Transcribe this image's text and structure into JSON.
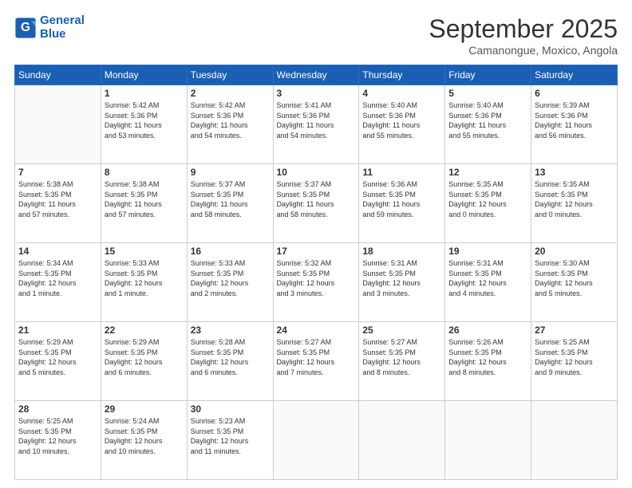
{
  "header": {
    "logo_line1": "General",
    "logo_line2": "Blue",
    "month": "September 2025",
    "location": "Camanongue, Moxico, Angola"
  },
  "weekdays": [
    "Sunday",
    "Monday",
    "Tuesday",
    "Wednesday",
    "Thursday",
    "Friday",
    "Saturday"
  ],
  "weeks": [
    [
      {
        "day": "",
        "info": ""
      },
      {
        "day": "1",
        "info": "Sunrise: 5:42 AM\nSunset: 5:36 PM\nDaylight: 11 hours\nand 53 minutes."
      },
      {
        "day": "2",
        "info": "Sunrise: 5:42 AM\nSunset: 5:36 PM\nDaylight: 11 hours\nand 54 minutes."
      },
      {
        "day": "3",
        "info": "Sunrise: 5:41 AM\nSunset: 5:36 PM\nDaylight: 11 hours\nand 54 minutes."
      },
      {
        "day": "4",
        "info": "Sunrise: 5:40 AM\nSunset: 5:36 PM\nDaylight: 11 hours\nand 55 minutes."
      },
      {
        "day": "5",
        "info": "Sunrise: 5:40 AM\nSunset: 5:36 PM\nDaylight: 11 hours\nand 55 minutes."
      },
      {
        "day": "6",
        "info": "Sunrise: 5:39 AM\nSunset: 5:36 PM\nDaylight: 11 hours\nand 56 minutes."
      }
    ],
    [
      {
        "day": "7",
        "info": "Sunrise: 5:38 AM\nSunset: 5:35 PM\nDaylight: 11 hours\nand 57 minutes."
      },
      {
        "day": "8",
        "info": "Sunrise: 5:38 AM\nSunset: 5:35 PM\nDaylight: 11 hours\nand 57 minutes."
      },
      {
        "day": "9",
        "info": "Sunrise: 5:37 AM\nSunset: 5:35 PM\nDaylight: 11 hours\nand 58 minutes."
      },
      {
        "day": "10",
        "info": "Sunrise: 5:37 AM\nSunset: 5:35 PM\nDaylight: 11 hours\nand 58 minutes."
      },
      {
        "day": "11",
        "info": "Sunrise: 5:36 AM\nSunset: 5:35 PM\nDaylight: 11 hours\nand 59 minutes."
      },
      {
        "day": "12",
        "info": "Sunrise: 5:35 AM\nSunset: 5:35 PM\nDaylight: 12 hours\nand 0 minutes."
      },
      {
        "day": "13",
        "info": "Sunrise: 5:35 AM\nSunset: 5:35 PM\nDaylight: 12 hours\nand 0 minutes."
      }
    ],
    [
      {
        "day": "14",
        "info": "Sunrise: 5:34 AM\nSunset: 5:35 PM\nDaylight: 12 hours\nand 1 minute."
      },
      {
        "day": "15",
        "info": "Sunrise: 5:33 AM\nSunset: 5:35 PM\nDaylight: 12 hours\nand 1 minute."
      },
      {
        "day": "16",
        "info": "Sunrise: 5:33 AM\nSunset: 5:35 PM\nDaylight: 12 hours\nand 2 minutes."
      },
      {
        "day": "17",
        "info": "Sunrise: 5:32 AM\nSunset: 5:35 PM\nDaylight: 12 hours\nand 3 minutes."
      },
      {
        "day": "18",
        "info": "Sunrise: 5:31 AM\nSunset: 5:35 PM\nDaylight: 12 hours\nand 3 minutes."
      },
      {
        "day": "19",
        "info": "Sunrise: 5:31 AM\nSunset: 5:35 PM\nDaylight: 12 hours\nand 4 minutes."
      },
      {
        "day": "20",
        "info": "Sunrise: 5:30 AM\nSunset: 5:35 PM\nDaylight: 12 hours\nand 5 minutes."
      }
    ],
    [
      {
        "day": "21",
        "info": "Sunrise: 5:29 AM\nSunset: 5:35 PM\nDaylight: 12 hours\nand 5 minutes."
      },
      {
        "day": "22",
        "info": "Sunrise: 5:29 AM\nSunset: 5:35 PM\nDaylight: 12 hours\nand 6 minutes."
      },
      {
        "day": "23",
        "info": "Sunrise: 5:28 AM\nSunset: 5:35 PM\nDaylight: 12 hours\nand 6 minutes."
      },
      {
        "day": "24",
        "info": "Sunrise: 5:27 AM\nSunset: 5:35 PM\nDaylight: 12 hours\nand 7 minutes."
      },
      {
        "day": "25",
        "info": "Sunrise: 5:27 AM\nSunset: 5:35 PM\nDaylight: 12 hours\nand 8 minutes."
      },
      {
        "day": "26",
        "info": "Sunrise: 5:26 AM\nSunset: 5:35 PM\nDaylight: 12 hours\nand 8 minutes."
      },
      {
        "day": "27",
        "info": "Sunrise: 5:25 AM\nSunset: 5:35 PM\nDaylight: 12 hours\nand 9 minutes."
      }
    ],
    [
      {
        "day": "28",
        "info": "Sunrise: 5:25 AM\nSunset: 5:35 PM\nDaylight: 12 hours\nand 10 minutes."
      },
      {
        "day": "29",
        "info": "Sunrise: 5:24 AM\nSunset: 5:35 PM\nDaylight: 12 hours\nand 10 minutes."
      },
      {
        "day": "30",
        "info": "Sunrise: 5:23 AM\nSunset: 5:35 PM\nDaylight: 12 hours\nand 11 minutes."
      },
      {
        "day": "",
        "info": ""
      },
      {
        "day": "",
        "info": ""
      },
      {
        "day": "",
        "info": ""
      },
      {
        "day": "",
        "info": ""
      }
    ]
  ]
}
